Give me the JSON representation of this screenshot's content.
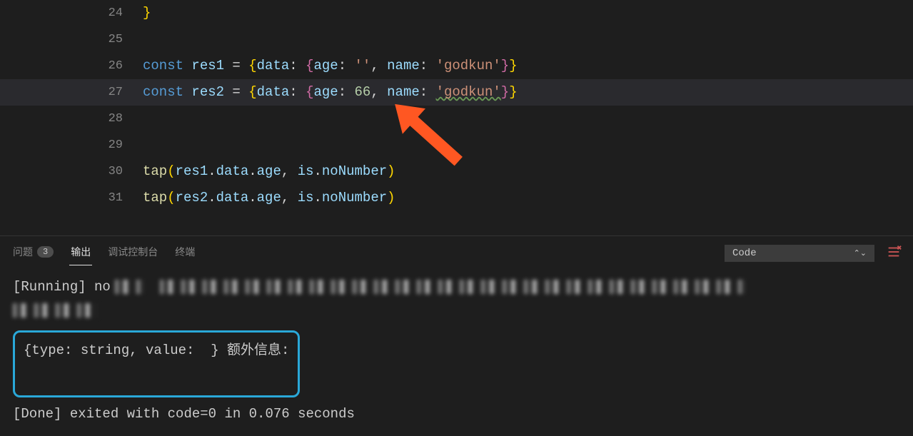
{
  "editor": {
    "lines": [
      {
        "num": "24",
        "tokens": [
          {
            "t": "brace3",
            "txt": "}"
          }
        ]
      },
      {
        "num": "25",
        "tokens": []
      },
      {
        "num": "26",
        "tokens": [
          {
            "t": "keyword",
            "txt": "const "
          },
          {
            "t": "variable",
            "txt": "res1"
          },
          {
            "t": "operator",
            "txt": " = "
          },
          {
            "t": "brace3",
            "txt": "{"
          },
          {
            "t": "property",
            "txt": "data"
          },
          {
            "t": "punct",
            "txt": ": "
          },
          {
            "t": "brace",
            "txt": "{"
          },
          {
            "t": "property",
            "txt": "age"
          },
          {
            "t": "punct",
            "txt": ": "
          },
          {
            "t": "string",
            "txt": "''"
          },
          {
            "t": "punct",
            "txt": ", "
          },
          {
            "t": "property",
            "txt": "name"
          },
          {
            "t": "punct",
            "txt": ": "
          },
          {
            "t": "string",
            "txt": "'godkun'"
          },
          {
            "t": "brace",
            "txt": "}"
          },
          {
            "t": "brace3",
            "txt": "}"
          }
        ]
      },
      {
        "num": "27",
        "highlight": true,
        "tokens": [
          {
            "t": "keyword",
            "txt": "const "
          },
          {
            "t": "variable",
            "txt": "res2"
          },
          {
            "t": "operator",
            "txt": " = "
          },
          {
            "t": "brace3",
            "txt": "{"
          },
          {
            "t": "property",
            "txt": "data"
          },
          {
            "t": "punct",
            "txt": ": "
          },
          {
            "t": "brace",
            "txt": "{"
          },
          {
            "t": "property",
            "txt": "age"
          },
          {
            "t": "punct",
            "txt": ": "
          },
          {
            "t": "number",
            "txt": "66"
          },
          {
            "t": "punct",
            "txt": ", "
          },
          {
            "t": "property",
            "txt": "name"
          },
          {
            "t": "punct",
            "txt": ": "
          },
          {
            "t": "string wavy-green",
            "txt": "'godkun'"
          },
          {
            "t": "brace",
            "txt": "}"
          },
          {
            "t": "brace3",
            "txt": "}"
          }
        ]
      },
      {
        "num": "28",
        "tokens": []
      },
      {
        "num": "29",
        "tokens": []
      },
      {
        "num": "30",
        "tokens": [
          {
            "t": "func",
            "txt": "tap"
          },
          {
            "t": "brace3",
            "txt": "("
          },
          {
            "t": "variable",
            "txt": "res1"
          },
          {
            "t": "punct",
            "txt": "."
          },
          {
            "t": "property",
            "txt": "data"
          },
          {
            "t": "punct",
            "txt": "."
          },
          {
            "t": "property",
            "txt": "age"
          },
          {
            "t": "punct",
            "txt": ", "
          },
          {
            "t": "variable",
            "txt": "is"
          },
          {
            "t": "punct",
            "txt": "."
          },
          {
            "t": "property",
            "txt": "noNumber"
          },
          {
            "t": "brace3",
            "txt": ")"
          }
        ]
      },
      {
        "num": "31",
        "tokens": [
          {
            "t": "func",
            "txt": "tap"
          },
          {
            "t": "brace3",
            "txt": "("
          },
          {
            "t": "variable",
            "txt": "res2"
          },
          {
            "t": "punct",
            "txt": "."
          },
          {
            "t": "property",
            "txt": "data"
          },
          {
            "t": "punct",
            "txt": "."
          },
          {
            "t": "property",
            "txt": "age"
          },
          {
            "t": "punct",
            "txt": ", "
          },
          {
            "t": "variable",
            "txt": "is"
          },
          {
            "t": "punct",
            "txt": "."
          },
          {
            "t": "property",
            "txt": "noNumber"
          },
          {
            "t": "brace3",
            "txt": ")"
          }
        ]
      }
    ]
  },
  "panel": {
    "tabs": {
      "problems": "问题",
      "problems_count": "3",
      "output": "输出",
      "debug_console": "调试控制台",
      "terminal": "终端"
    },
    "dropdown": "Code",
    "output": {
      "running_prefix": "[Running] no",
      "highlighted": "{type: string, value:  } 额外信息:",
      "done": "[Done] exited with code=0 in 0.076 seconds"
    }
  }
}
